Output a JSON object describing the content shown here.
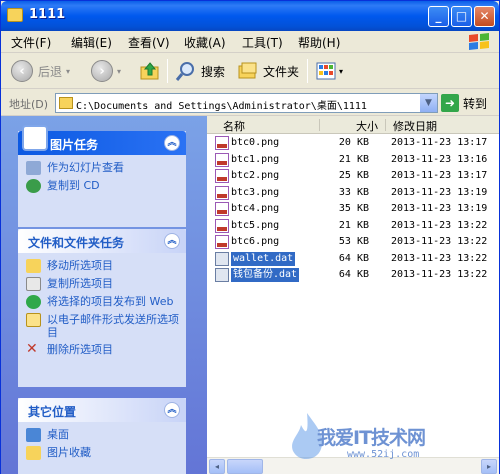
{
  "window": {
    "title": "1111"
  },
  "titlebar": {
    "min": "_",
    "max": "□",
    "close": "✕"
  },
  "menu": [
    "文件(F)",
    "编辑(E)",
    "查看(V)",
    "收藏(A)",
    "工具(T)",
    "帮助(H)"
  ],
  "toolbar": {
    "back": "后退",
    "forward_glyph": "›",
    "back_glyph": "‹",
    "search": "搜索",
    "folders": "文件夹"
  },
  "address": {
    "label": "地址(D)",
    "path": "C:\\Documents and Settings\\Administrator\\桌面\\1111",
    "go": "转到"
  },
  "left_panel": {
    "picture_tasks": {
      "title": "图片任务",
      "items": [
        "作为幻灯片查看",
        "复制到 CD"
      ]
    },
    "file_tasks": {
      "title": "文件和文件夹任务",
      "items": [
        "移动所选项目",
        "复制所选项目",
        "将选择的项目发布到 Web",
        "以电子邮件形式发送所选项目",
        "删除所选项目"
      ]
    },
    "other_places": {
      "title": "其它位置",
      "items": [
        "桌面",
        "图片收藏"
      ]
    }
  },
  "columns": {
    "name": "名称",
    "size": "大小",
    "modified": "修改日期"
  },
  "files": [
    {
      "name": "btc0.png",
      "size": "20 KB",
      "date": "2013-11-23 13:17",
      "type": "png",
      "selected": false
    },
    {
      "name": "btc1.png",
      "size": "21 KB",
      "date": "2013-11-23 13:16",
      "type": "png",
      "selected": false
    },
    {
      "name": "btc2.png",
      "size": "25 KB",
      "date": "2013-11-23 13:17",
      "type": "png",
      "selected": false
    },
    {
      "name": "btc3.png",
      "size": "33 KB",
      "date": "2013-11-23 13:19",
      "type": "png",
      "selected": false
    },
    {
      "name": "btc4.png",
      "size": "35 KB",
      "date": "2013-11-23 13:19",
      "type": "png",
      "selected": false
    },
    {
      "name": "btc5.png",
      "size": "21 KB",
      "date": "2013-11-23 13:22",
      "type": "png",
      "selected": false
    },
    {
      "name": "btc6.png",
      "size": "53 KB",
      "date": "2013-11-23 13:22",
      "type": "png",
      "selected": false
    },
    {
      "name": "wallet.dat",
      "size": "64 KB",
      "date": "2013-11-23 13:22",
      "type": "dat",
      "selected": true
    },
    {
      "name": "钱包备份.dat",
      "size": "64 KB",
      "date": "2013-11-23 13:22",
      "type": "dat",
      "selected": true
    }
  ],
  "scroll": {
    "left": "◂",
    "right": "▸"
  },
  "watermark": {
    "line1": "我爱IT技术网",
    "line2": "www.52ij.com"
  },
  "colors": {
    "selection": "#316ac5",
    "link": "#215dc6",
    "titlebar": "#0058ee"
  }
}
